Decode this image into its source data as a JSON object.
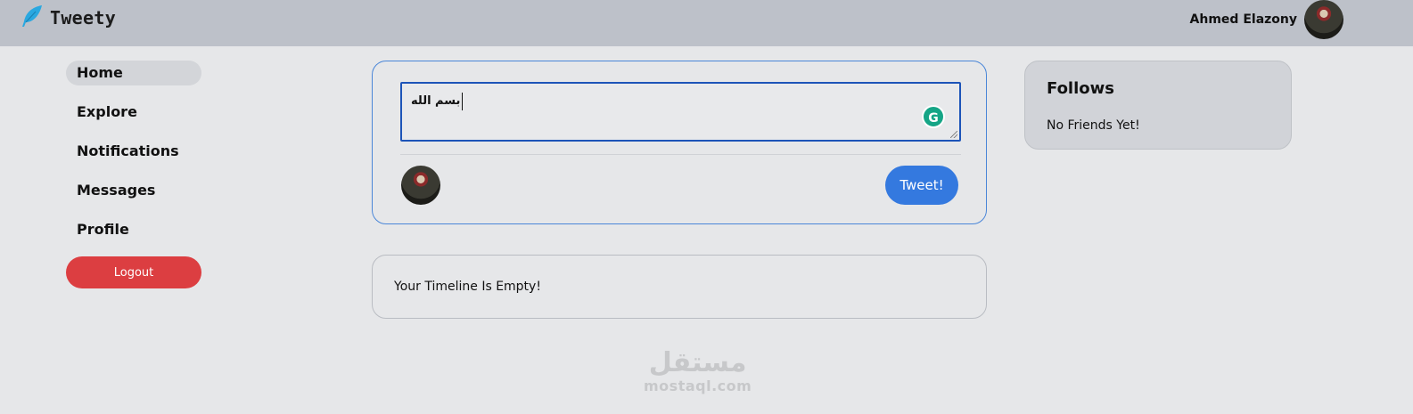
{
  "header": {
    "brand": "Tweety",
    "brand_icon": "feather-icon",
    "user_name": "Ahmed Elazony"
  },
  "sidebar": {
    "items": [
      {
        "label": "Home",
        "active": true
      },
      {
        "label": "Explore",
        "active": false
      },
      {
        "label": "Notifications",
        "active": false
      },
      {
        "label": "Messages",
        "active": false
      },
      {
        "label": "Profile",
        "active": false
      }
    ],
    "logout_label": "Logout"
  },
  "composer": {
    "text": "بسم الله",
    "submit_label": "Tweet!"
  },
  "timeline": {
    "empty_message": "Your Timeline Is Empty!"
  },
  "follows": {
    "title": "Follows",
    "empty_message": "No Friends Yet!"
  },
  "watermark": {
    "arabic": "مستقل",
    "latin": "mostaql.com"
  },
  "colors": {
    "accent": "#3479df",
    "logout": "#dc3e41",
    "header_bg": "#bdc1c9",
    "page_bg": "#e6e7e9",
    "brand_icon": "#2aa8e0",
    "grammarly": "#15a586"
  }
}
